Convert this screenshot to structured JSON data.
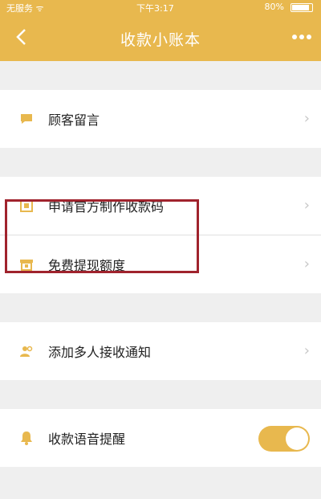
{
  "statusbar": {
    "carrier": "无服务 ᯤ",
    "time": "下午3:17",
    "battery_text": "80%"
  },
  "navbar": {
    "title": "收款小账本"
  },
  "menu": {
    "items": [
      {
        "label": "顾客留言",
        "icon": "message-icon"
      },
      {
        "label": "申请官方制作收款码",
        "icon": "qr-code-icon"
      },
      {
        "label": "免费提现额度",
        "icon": "quota-icon"
      },
      {
        "label": "添加多人接收通知",
        "icon": "people-icon"
      },
      {
        "label": "收款语音提醒",
        "icon": "bell-icon"
      }
    ],
    "chevron": "›"
  },
  "toggle": {
    "voice_reminder_on": true
  },
  "colors": {
    "accent": "#e8b84e",
    "highlight": "#a0232d"
  }
}
